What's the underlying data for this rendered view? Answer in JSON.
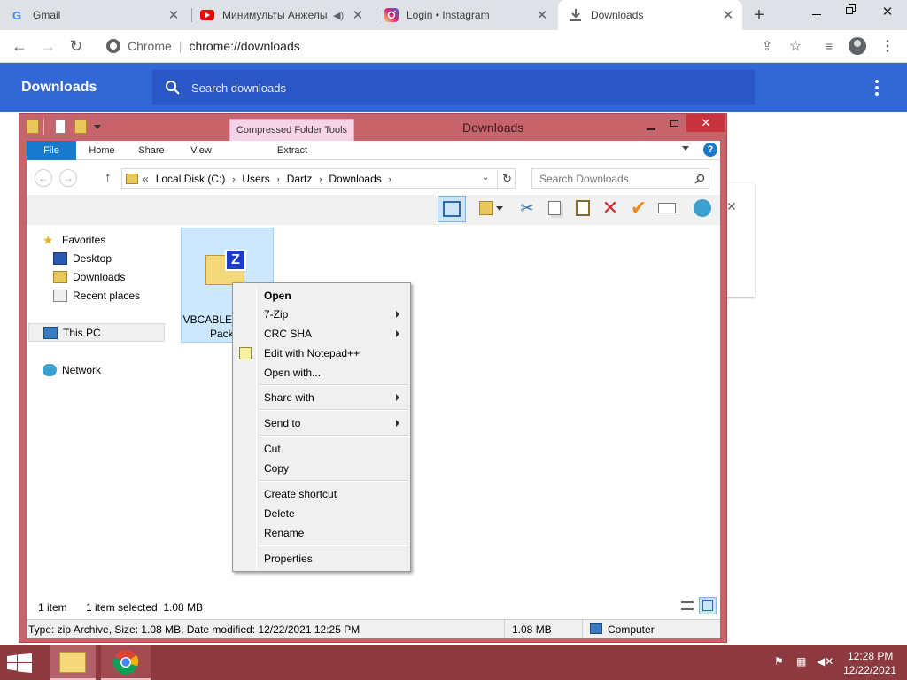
{
  "tabs": [
    {
      "title": "Gmail",
      "icon": "gmail-icon"
    },
    {
      "title": "Минимульты Анжелы",
      "icon": "youtube-icon"
    },
    {
      "title": "Login • Instagram",
      "icon": "instagram-icon"
    },
    {
      "title": "Downloads",
      "icon": "download-icon"
    }
  ],
  "omnibox": {
    "site": "Chrome",
    "separator": "|",
    "url": "chrome://downloads"
  },
  "downloads": {
    "title": "Downloads",
    "search_placeholder": "Search downloads"
  },
  "explorer": {
    "title": "Downloads",
    "contextual_tab": "Compressed Folder Tools",
    "ribbon_tabs": [
      "File",
      "Home",
      "Share",
      "View"
    ],
    "contextual_subtab": "Extract",
    "breadcrumb": {
      "prefix": "«",
      "parts": [
        "Local Disk (C:)",
        "Users",
        "Dartz",
        "Downloads"
      ]
    },
    "search_placeholder": "Search Downloads",
    "nav": {
      "favorites": "Favorites",
      "favorite_items": [
        "Desktop",
        "Downloads",
        "Recent places"
      ],
      "this_pc": "This PC",
      "network": "Network"
    },
    "file": {
      "name_line1": "VBCABLE_Driver_",
      "name_line2": "Pack43"
    },
    "status": {
      "items": "1 item",
      "selected": "1 item selected  1.08 MB"
    },
    "details": {
      "info": "Type: zip Archive, Size: 1.08 MB, Date modified: 12/22/2021 12:25 PM",
      "size": "1.08 MB",
      "location": "Computer"
    }
  },
  "context_menu": {
    "open": "Open",
    "sevenzip": "7-Zip",
    "crcsha": "CRC SHA",
    "notepad": "Edit with Notepad++",
    "openwith": "Open with...",
    "sharewith": "Share with",
    "sendto": "Send to",
    "cut": "Cut",
    "copy": "Copy",
    "shortcut": "Create shortcut",
    "delete": "Delete",
    "rename": "Rename",
    "properties": "Properties"
  },
  "taskbar": {
    "time": "12:28 PM",
    "date": "12/22/2021"
  },
  "colors": {
    "chrome_header": "#3367d6",
    "explorer_frame": "#c7636a",
    "taskbar": "#8c3a40",
    "file_tab": "#1979ca"
  }
}
